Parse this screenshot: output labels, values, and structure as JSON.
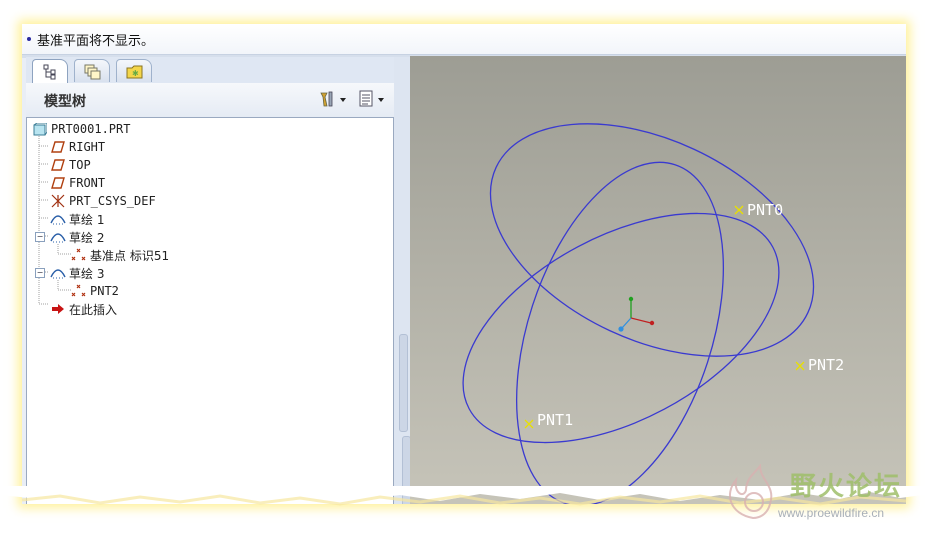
{
  "message_bar": {
    "text": "基准平面将不显示。"
  },
  "left_panel": {
    "tabs": [
      {
        "name": "model-tree-tab",
        "icon": "tree-icon",
        "active": true
      },
      {
        "name": "layers-tab",
        "icon": "layers-icon",
        "active": false
      },
      {
        "name": "favorites-tab",
        "icon": "folder-icon",
        "active": false
      }
    ],
    "title": "模型树",
    "settings_icon": "tools-icon",
    "show_icon": "list-icon"
  },
  "tree": {
    "items": [
      {
        "label": "PRT0001.PRT",
        "icon": "part-icon"
      },
      {
        "label": "RIGHT",
        "icon": "datum-plane-icon"
      },
      {
        "label": "TOP",
        "icon": "datum-plane-icon"
      },
      {
        "label": "FRONT",
        "icon": "datum-plane-icon"
      },
      {
        "label": "PRT_CSYS_DEF",
        "icon": "csys-icon"
      },
      {
        "label": "草绘 1",
        "icon": "sketch-icon"
      },
      {
        "label": "草绘 2",
        "icon": "sketch-icon",
        "expanded": true
      },
      {
        "label": "基准点 标识51",
        "icon": "datum-point-icon"
      },
      {
        "label": "草绘 3",
        "icon": "sketch-icon",
        "expanded": true
      },
      {
        "label": "PNT2",
        "icon": "datum-point-icon"
      },
      {
        "label": "在此插入",
        "icon": "insert-arrow-icon"
      }
    ]
  },
  "viewport": {
    "points": [
      {
        "label": "PNT0"
      },
      {
        "label": "PNT2"
      },
      {
        "label": "PNT1"
      }
    ],
    "curve_color": "#3a3ad0",
    "point_color": "#e8e000",
    "axes_colors": {
      "x": "#c02020",
      "y": "#20a020",
      "z": "#3090e0"
    }
  },
  "watermark": {
    "title": "野火论坛",
    "url": "www.proewildfire.cn"
  }
}
